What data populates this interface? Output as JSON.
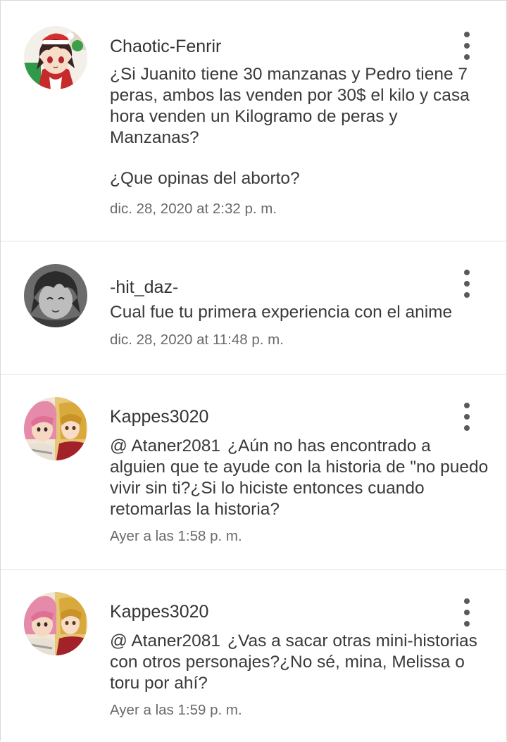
{
  "comments": [
    {
      "username": "Chaotic-Fenrir",
      "avatar_icon": "anime-christmas-avatar",
      "lines": [
        "¿Si Juanito tiene 30 manzanas y Pedro tiene 7 peras, ambos las venden por 30$ el kilo y casa hora venden un Kilogramo de peras y Manzanas?",
        "¿Que opinas del aborto?"
      ],
      "timestamp": "dic. 28, 2020 at 2:32 p. m."
    },
    {
      "username": "-hit_daz-",
      "avatar_icon": "anime-grayscale-avatar",
      "text": "Cual fue tu primera experiencia con el anime",
      "timestamp": "dic. 28, 2020 at 11:48 p. m."
    },
    {
      "username": "Kappes3020",
      "avatar_icon": "anime-duo-avatar",
      "mention": "@ Ataner2081",
      "text": "¿Aún no has encontrado a alguien que te ayude con la historia de \"no puedo vivir sin ti?¿Si lo hiciste entonces cuando retomarlas la historia?",
      "timestamp": "Ayer a las 1:58 p. m."
    },
    {
      "username": "Kappes3020",
      "avatar_icon": "anime-duo-avatar",
      "mention": "@ Ataner2081",
      "text": "¿Vas a sacar otras mini-historias con otros personajes?¿No sé, mina, Melissa o toru por ahí?",
      "timestamp": "Ayer a las 1:59 p. m."
    }
  ],
  "menu_icon": "more-vert-icon",
  "colors": {
    "text": "#3a3a3a",
    "meta": "#6a6a6a",
    "divider": "#e0e0e0",
    "menu": "#5a5a5a"
  }
}
